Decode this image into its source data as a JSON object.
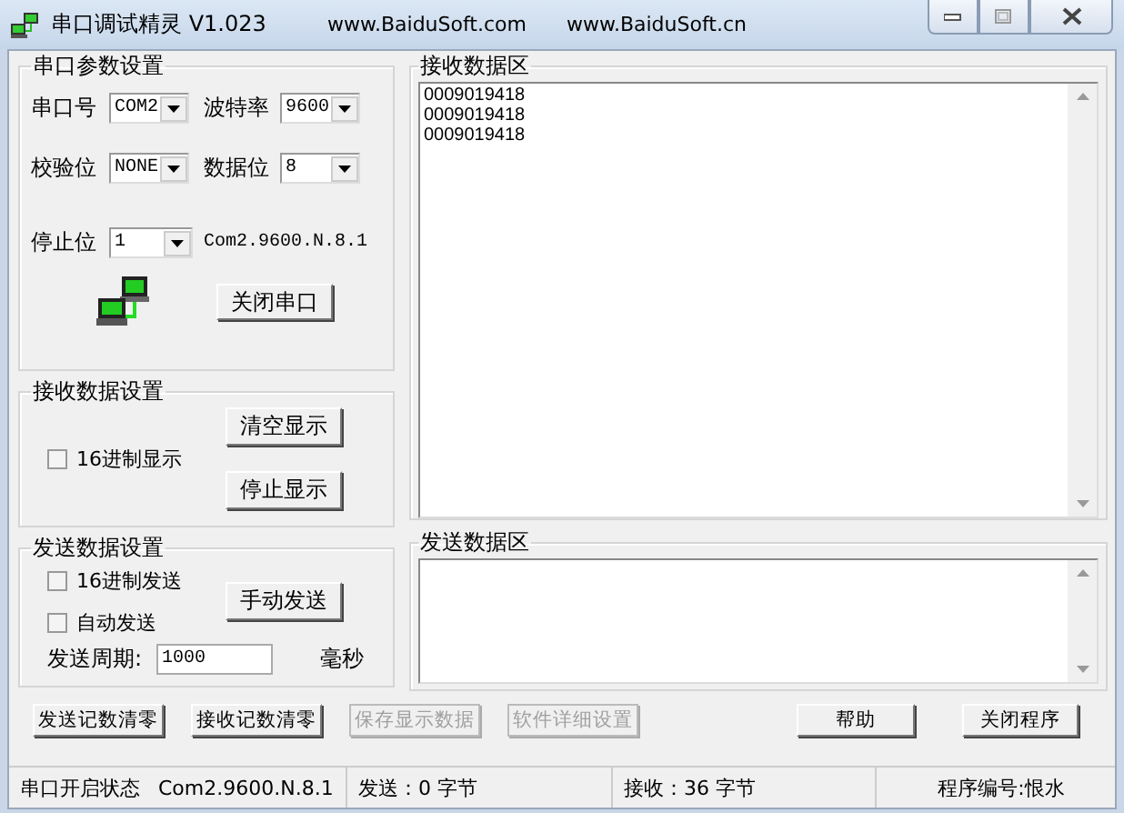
{
  "window": {
    "title": "串口调试精灵 V1.023",
    "links": [
      "www.BaiduSoft.com",
      "www.BaiduSoft.cn"
    ]
  },
  "serial_settings": {
    "title": "串口参数设置",
    "fields": [
      {
        "label": "串口号",
        "value": "COM2"
      },
      {
        "label": "波特率",
        "value": "9600"
      },
      {
        "label": "校验位",
        "value": "NONE"
      },
      {
        "label": "数据位",
        "value": "8"
      },
      {
        "label": "停止位",
        "value": "1"
      }
    ],
    "summary": "Com2.9600.N.8.1",
    "button": "关闭串口"
  },
  "receive_settings": {
    "title": "接收数据设置",
    "checkbox": {
      "label": "16进制显示",
      "checked": false
    },
    "buttons": [
      "清空显示",
      "停止显示"
    ]
  },
  "send_settings": {
    "title": "发送数据设置",
    "checkboxes": [
      {
        "label": "16进制发送",
        "checked": false
      },
      {
        "label": "自动发送",
        "checked": false
      }
    ],
    "button": "手动发送",
    "period": {
      "label": "发送周期:",
      "value": "1000",
      "unit": "毫秒"
    }
  },
  "receive_area": {
    "title": "接收数据区",
    "lines": [
      "0009019418",
      "0009019418",
      "0009019418"
    ]
  },
  "send_area": {
    "title": "发送数据区"
  },
  "buttons": [
    {
      "label": "发送记数清零",
      "disabled": false
    },
    {
      "label": "接收记数清零",
      "disabled": false
    },
    {
      "label": "保存显示数据",
      "disabled": true
    },
    {
      "label": "软件详细设置",
      "disabled": true
    },
    {
      "label": "帮助",
      "disabled": false
    },
    {
      "label": "关闭程序",
      "disabled": false
    }
  ],
  "status_bar": [
    {
      "texts": [
        "串口开启状态",
        "Com2.9600.N.8.1"
      ]
    },
    {
      "texts": [
        "发送：0 字节"
      ]
    },
    {
      "texts": [
        "接收：36 字节"
      ]
    },
    {
      "texts": [
        "程序编号:恨水"
      ]
    }
  ]
}
